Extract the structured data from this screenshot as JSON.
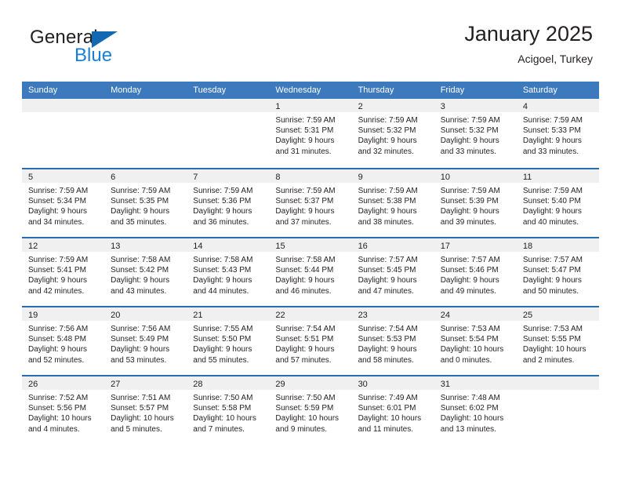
{
  "logo": {
    "text_primary": "General",
    "text_secondary": "Blue",
    "triangle_color": "#1268b3",
    "secondary_color": "#1a7fd4"
  },
  "header": {
    "title": "January 2025",
    "subtitle": "Acigoel, Turkey"
  },
  "theme": {
    "header_blue": "#3c79bd",
    "row_rule_blue": "#2b6cae",
    "daynum_band": "#f0f0f0",
    "text": "#231f20"
  },
  "weekday_headers": [
    "Sunday",
    "Monday",
    "Tuesday",
    "Wednesday",
    "Thursday",
    "Friday",
    "Saturday"
  ],
  "weeks": [
    [
      {
        "day": "",
        "lines": []
      },
      {
        "day": "",
        "lines": []
      },
      {
        "day": "",
        "lines": []
      },
      {
        "day": "1",
        "lines": [
          "Sunrise: 7:59 AM",
          "Sunset: 5:31 PM",
          "Daylight: 9 hours",
          "and 31 minutes."
        ]
      },
      {
        "day": "2",
        "lines": [
          "Sunrise: 7:59 AM",
          "Sunset: 5:32 PM",
          "Daylight: 9 hours",
          "and 32 minutes."
        ]
      },
      {
        "day": "3",
        "lines": [
          "Sunrise: 7:59 AM",
          "Sunset: 5:32 PM",
          "Daylight: 9 hours",
          "and 33 minutes."
        ]
      },
      {
        "day": "4",
        "lines": [
          "Sunrise: 7:59 AM",
          "Sunset: 5:33 PM",
          "Daylight: 9 hours",
          "and 33 minutes."
        ]
      }
    ],
    [
      {
        "day": "5",
        "lines": [
          "Sunrise: 7:59 AM",
          "Sunset: 5:34 PM",
          "Daylight: 9 hours",
          "and 34 minutes."
        ]
      },
      {
        "day": "6",
        "lines": [
          "Sunrise: 7:59 AM",
          "Sunset: 5:35 PM",
          "Daylight: 9 hours",
          "and 35 minutes."
        ]
      },
      {
        "day": "7",
        "lines": [
          "Sunrise: 7:59 AM",
          "Sunset: 5:36 PM",
          "Daylight: 9 hours",
          "and 36 minutes."
        ]
      },
      {
        "day": "8",
        "lines": [
          "Sunrise: 7:59 AM",
          "Sunset: 5:37 PM",
          "Daylight: 9 hours",
          "and 37 minutes."
        ]
      },
      {
        "day": "9",
        "lines": [
          "Sunrise: 7:59 AM",
          "Sunset: 5:38 PM",
          "Daylight: 9 hours",
          "and 38 minutes."
        ]
      },
      {
        "day": "10",
        "lines": [
          "Sunrise: 7:59 AM",
          "Sunset: 5:39 PM",
          "Daylight: 9 hours",
          "and 39 minutes."
        ]
      },
      {
        "day": "11",
        "lines": [
          "Sunrise: 7:59 AM",
          "Sunset: 5:40 PM",
          "Daylight: 9 hours",
          "and 40 minutes."
        ]
      }
    ],
    [
      {
        "day": "12",
        "lines": [
          "Sunrise: 7:59 AM",
          "Sunset: 5:41 PM",
          "Daylight: 9 hours",
          "and 42 minutes."
        ]
      },
      {
        "day": "13",
        "lines": [
          "Sunrise: 7:58 AM",
          "Sunset: 5:42 PM",
          "Daylight: 9 hours",
          "and 43 minutes."
        ]
      },
      {
        "day": "14",
        "lines": [
          "Sunrise: 7:58 AM",
          "Sunset: 5:43 PM",
          "Daylight: 9 hours",
          "and 44 minutes."
        ]
      },
      {
        "day": "15",
        "lines": [
          "Sunrise: 7:58 AM",
          "Sunset: 5:44 PM",
          "Daylight: 9 hours",
          "and 46 minutes."
        ]
      },
      {
        "day": "16",
        "lines": [
          "Sunrise: 7:57 AM",
          "Sunset: 5:45 PM",
          "Daylight: 9 hours",
          "and 47 minutes."
        ]
      },
      {
        "day": "17",
        "lines": [
          "Sunrise: 7:57 AM",
          "Sunset: 5:46 PM",
          "Daylight: 9 hours",
          "and 49 minutes."
        ]
      },
      {
        "day": "18",
        "lines": [
          "Sunrise: 7:57 AM",
          "Sunset: 5:47 PM",
          "Daylight: 9 hours",
          "and 50 minutes."
        ]
      }
    ],
    [
      {
        "day": "19",
        "lines": [
          "Sunrise: 7:56 AM",
          "Sunset: 5:48 PM",
          "Daylight: 9 hours",
          "and 52 minutes."
        ]
      },
      {
        "day": "20",
        "lines": [
          "Sunrise: 7:56 AM",
          "Sunset: 5:49 PM",
          "Daylight: 9 hours",
          "and 53 minutes."
        ]
      },
      {
        "day": "21",
        "lines": [
          "Sunrise: 7:55 AM",
          "Sunset: 5:50 PM",
          "Daylight: 9 hours",
          "and 55 minutes."
        ]
      },
      {
        "day": "22",
        "lines": [
          "Sunrise: 7:54 AM",
          "Sunset: 5:51 PM",
          "Daylight: 9 hours",
          "and 57 minutes."
        ]
      },
      {
        "day": "23",
        "lines": [
          "Sunrise: 7:54 AM",
          "Sunset: 5:53 PM",
          "Daylight: 9 hours",
          "and 58 minutes."
        ]
      },
      {
        "day": "24",
        "lines": [
          "Sunrise: 7:53 AM",
          "Sunset: 5:54 PM",
          "Daylight: 10 hours",
          "and 0 minutes."
        ]
      },
      {
        "day": "25",
        "lines": [
          "Sunrise: 7:53 AM",
          "Sunset: 5:55 PM",
          "Daylight: 10 hours",
          "and 2 minutes."
        ]
      }
    ],
    [
      {
        "day": "26",
        "lines": [
          "Sunrise: 7:52 AM",
          "Sunset: 5:56 PM",
          "Daylight: 10 hours",
          "and 4 minutes."
        ]
      },
      {
        "day": "27",
        "lines": [
          "Sunrise: 7:51 AM",
          "Sunset: 5:57 PM",
          "Daylight: 10 hours",
          "and 5 minutes."
        ]
      },
      {
        "day": "28",
        "lines": [
          "Sunrise: 7:50 AM",
          "Sunset: 5:58 PM",
          "Daylight: 10 hours",
          "and 7 minutes."
        ]
      },
      {
        "day": "29",
        "lines": [
          "Sunrise: 7:50 AM",
          "Sunset: 5:59 PM",
          "Daylight: 10 hours",
          "and 9 minutes."
        ]
      },
      {
        "day": "30",
        "lines": [
          "Sunrise: 7:49 AM",
          "Sunset: 6:01 PM",
          "Daylight: 10 hours",
          "and 11 minutes."
        ]
      },
      {
        "day": "31",
        "lines": [
          "Sunrise: 7:48 AM",
          "Sunset: 6:02 PM",
          "Daylight: 10 hours",
          "and 13 minutes."
        ]
      },
      {
        "day": "",
        "lines": []
      }
    ]
  ]
}
